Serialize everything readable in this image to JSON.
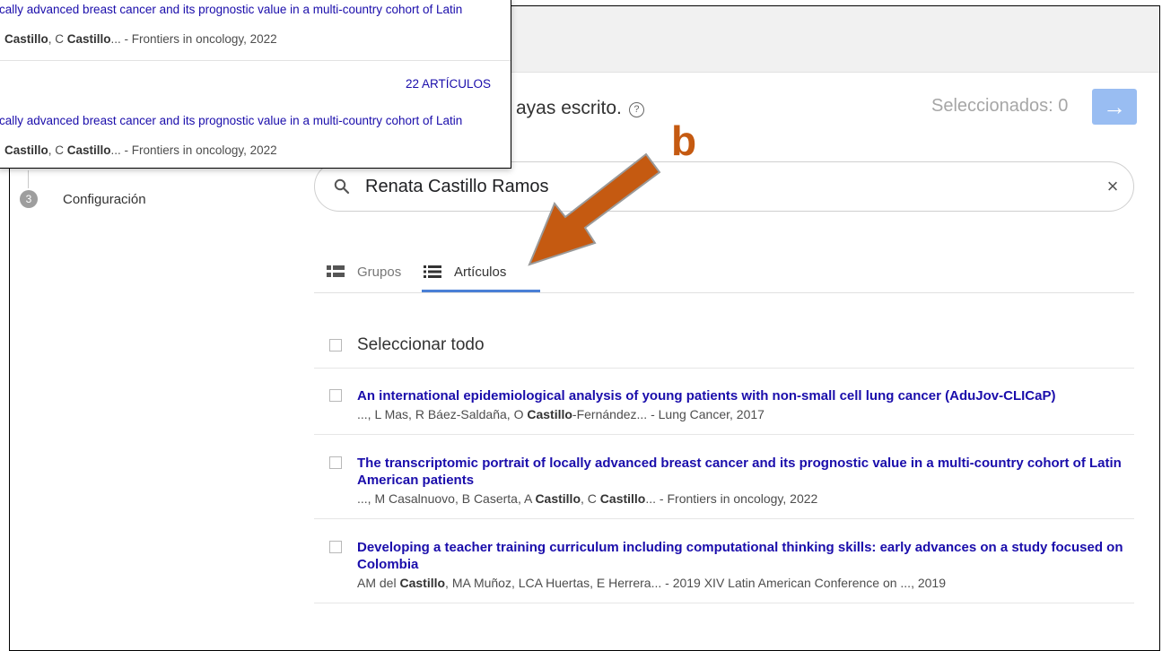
{
  "popup": {
    "row1_title": "cally advanced breast cancer and its prognostic value in a multi-country cohort of Latin",
    "row1_meta_a": "Castillo",
    "row1_meta_b": ", C ",
    "row1_meta_c": "Castillo",
    "row1_meta_d": "... - Frontiers in oncology, 2022",
    "count_label": "22 ARTÍCULOS",
    "row2_title": "cally advanced breast cancer and its prognostic value in a multi-country cohort of Latin",
    "row2_meta_a": "Castillo",
    "row2_meta_b": ", C ",
    "row2_meta_c": "Castillo",
    "row2_meta_d": "... - Frontiers in oncology, 2022"
  },
  "sidebar": {
    "step_number": "3",
    "step_label": "Configuración"
  },
  "header": {
    "heading_fragment": "ayas escrito.",
    "help_glyph": "?",
    "selected_label": "Seleccionados: 0",
    "next_glyph": "→"
  },
  "search": {
    "value": "Renata Castillo Ramos",
    "clear_glyph": "×"
  },
  "tabs": {
    "groups_label": "Grupos",
    "articles_label": "Artículos"
  },
  "select_all_label": "Seleccionar todo",
  "results": [
    {
      "title": "An international epidemiological analysis of young patients with non-small cell lung cancer (AduJov-CLICaP)",
      "meta_pre": "..., L Mas, R Báez-Saldaña, O ",
      "meta_bold": "Castillo",
      "meta_post": "-Fernández... - Lung Cancer, 2017"
    },
    {
      "title": "The transcriptomic portrait of locally advanced breast cancer and its prognostic value in a multi-country cohort of Latin American patients",
      "meta_pre": "..., M Casalnuovo, B Caserta, A ",
      "meta_bold": "Castillo",
      "meta_mid": ", C ",
      "meta_bold2": "Castillo",
      "meta_post": "... - Frontiers in oncology, 2022"
    },
    {
      "title": "Developing a teacher training curriculum including computational thinking skills: early advances on a study focused on Colombia",
      "meta_pre": "AM del ",
      "meta_bold": "Castillo",
      "meta_post": ", MA Muñoz, LCA Huertas, E Herrera... - 2019 XIV Latin American Conference on ..., 2019"
    }
  ],
  "annotation": {
    "label": "b",
    "color": "#c55a11"
  },
  "colors": {
    "link": "#1a0dab",
    "accent_blue": "#4a7fd6",
    "next_button": "#99bdf2"
  }
}
